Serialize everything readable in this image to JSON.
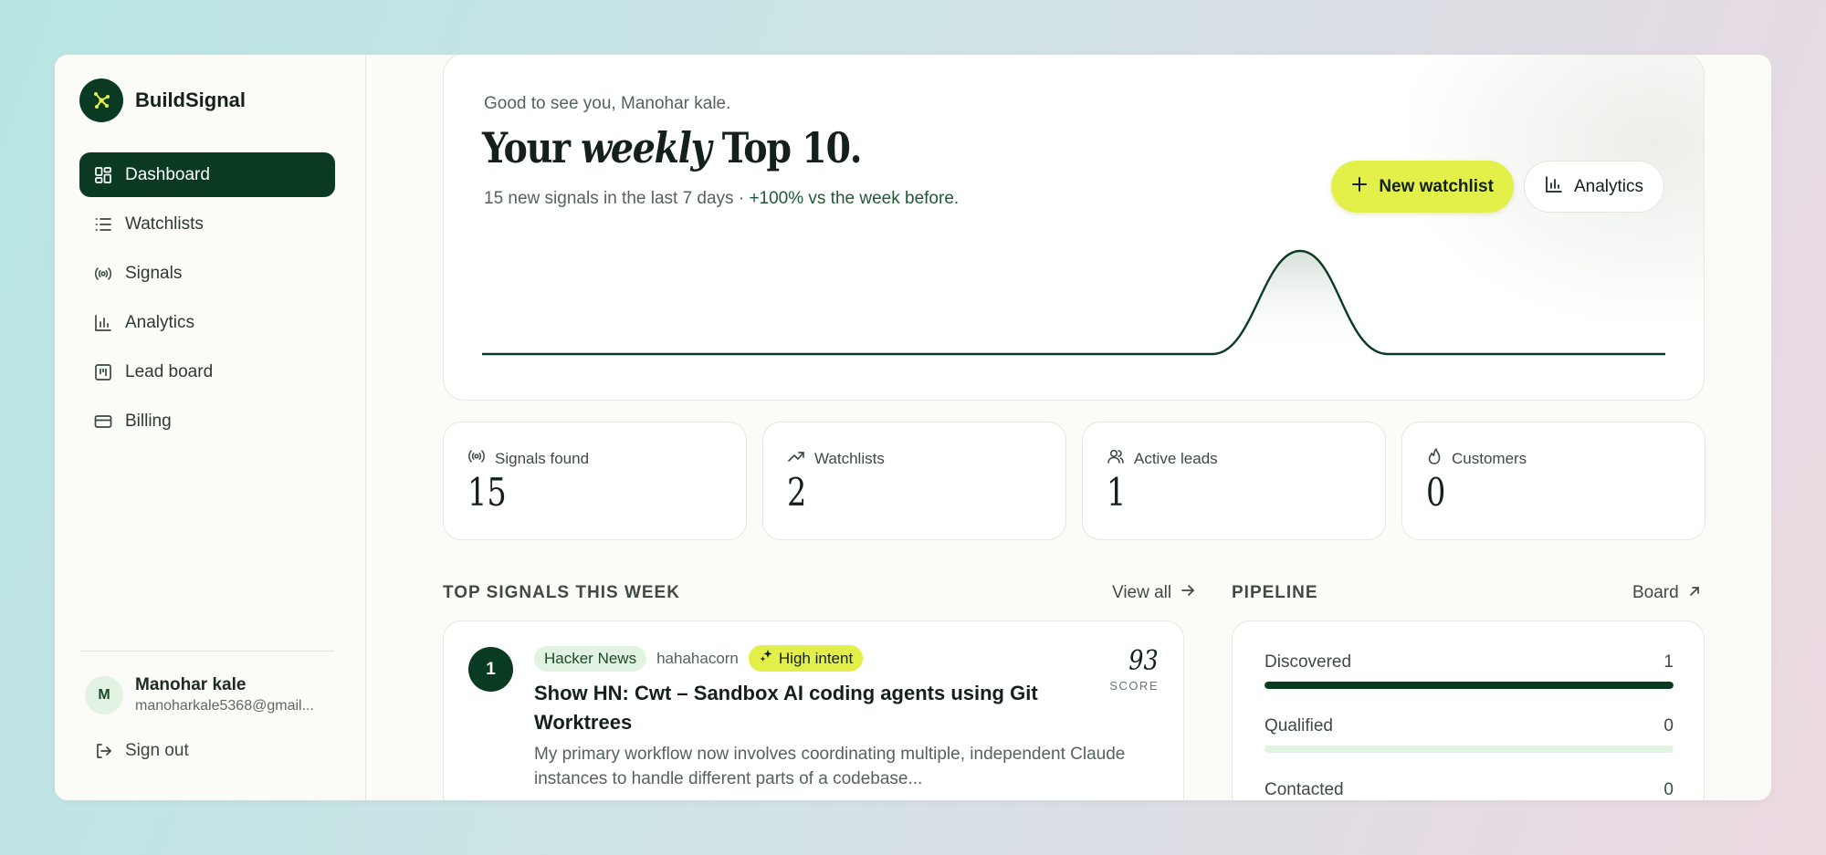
{
  "brand": {
    "name": "BuildSignal"
  },
  "nav": {
    "items": [
      {
        "label": "Dashboard",
        "icon": "dashboard-icon",
        "active": true
      },
      {
        "label": "Watchlists",
        "icon": "list-icon",
        "active": false
      },
      {
        "label": "Signals",
        "icon": "broadcast-icon",
        "active": false
      },
      {
        "label": "Analytics",
        "icon": "bar-chart-icon",
        "active": false
      },
      {
        "label": "Lead board",
        "icon": "kanban-icon",
        "active": false
      },
      {
        "label": "Billing",
        "icon": "credit-card-icon",
        "active": false
      }
    ]
  },
  "user": {
    "initial": "M",
    "name": "Manohar kale",
    "email": "manoharkale5368@gmail...",
    "signout_label": "Sign out"
  },
  "hero": {
    "greeting": "Good to see you, Manohar kale.",
    "title_prefix": "Your ",
    "title_italic": "weekly",
    "title_suffix": " Top 10.",
    "subtitle_main": "15 new signals in the last 7 days · ",
    "subtitle_delta": "+100% vs the week before.",
    "new_watchlist_label": "New watchlist",
    "analytics_label": "Analytics"
  },
  "stats": [
    {
      "label": "Signals found",
      "value": "15",
      "icon": "broadcast-icon"
    },
    {
      "label": "Watchlists",
      "value": "2",
      "icon": "trending-up-icon"
    },
    {
      "label": "Active leads",
      "value": "1",
      "icon": "users-icon"
    },
    {
      "label": "Customers",
      "value": "0",
      "icon": "flame-icon"
    }
  ],
  "top_signals": {
    "section_title": "TOP SIGNALS THIS WEEK",
    "view_all_label": "View all",
    "items": [
      {
        "rank": "1",
        "source": "Hacker News",
        "author": "hahahacorn",
        "intent": "High intent",
        "title": "Show HN: Cwt – Sandbox AI coding agents using Git Worktrees",
        "description": "My primary workflow now involves coordinating multiple, independent Claude instances to handle different parts of a codebase...",
        "score": "93",
        "score_label": "SCORE"
      }
    ]
  },
  "pipeline": {
    "section_title": "PIPELINE",
    "board_label": "Board",
    "stages": [
      {
        "label": "Discovered",
        "count": "1",
        "fill": 1.0
      },
      {
        "label": "Qualified",
        "count": "0",
        "fill": 0.0
      },
      {
        "label": "Contacted",
        "count": "0",
        "fill": 0.0
      }
    ]
  },
  "colors": {
    "brand_green": "#0b3a22",
    "accent_lime": "#e3f04a",
    "pale_green": "#e2f2e3"
  }
}
